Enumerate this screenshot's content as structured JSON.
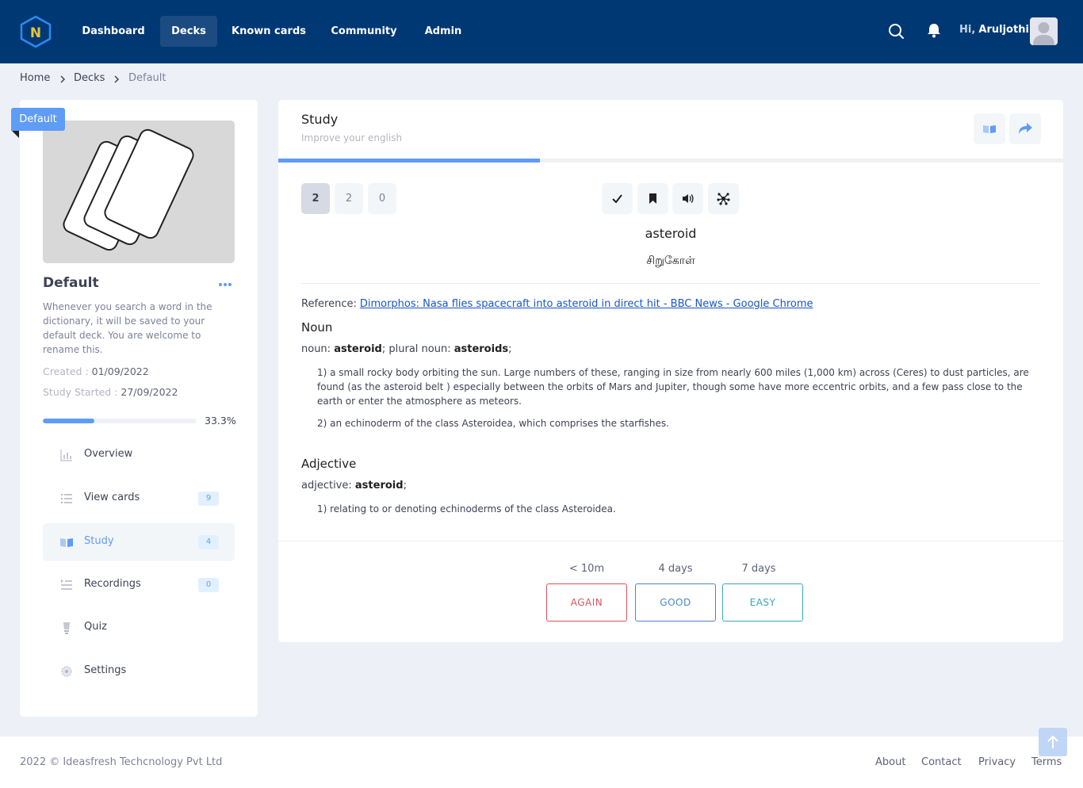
{
  "header": {
    "logo_letter": "N",
    "nav": [
      {
        "label": "Dashboard"
      },
      {
        "label": "Decks"
      },
      {
        "label": "Known cards"
      },
      {
        "label": "Community"
      },
      {
        "label": "Admin"
      }
    ],
    "greeting_prefix": "Hi,",
    "user_name": "Aruljothi"
  },
  "breadcrumb": [
    "Home",
    "Decks",
    "Default"
  ],
  "deck": {
    "ribbon": "Default",
    "title": "Default",
    "description": "Whenever you search a word in the dictionary, it will be saved to your default deck. You are welcome to rename this.",
    "created_label": "Created :",
    "created_value": "01/09/2022",
    "started_label": "Study Started :",
    "started_value": "27/09/2022",
    "progress": 0.333,
    "progress_label": "33.3%"
  },
  "menu": [
    {
      "label": "Overview",
      "icon": "chart-icon"
    },
    {
      "label": "View cards",
      "icon": "list-icon",
      "badge": "9"
    },
    {
      "label": "Study",
      "icon": "book-icon",
      "badge": "4"
    },
    {
      "label": "Recordings",
      "icon": "recordings-icon",
      "badge": "0"
    },
    {
      "label": "Quiz",
      "icon": "bulb-icon"
    },
    {
      "label": "Settings",
      "icon": "gear-icon"
    }
  ],
  "study": {
    "title": "Study",
    "subtitle": "Improve your english",
    "progress": 0.333,
    "counts": [
      "2",
      "2",
      "0"
    ],
    "word": "asteroid",
    "translation": "சிறுகோள்",
    "reference_label": "Reference:",
    "reference_link": "Dimorphos: Nasa flies spacecraft into asteroid in direct hit - BBC News - Google Chrome",
    "noun_head": "Noun",
    "noun_forms_label": "noun:",
    "noun_form": "asteroid",
    "plural_label": "; plural noun:",
    "plural_form": "asteroids",
    "form_end": ";",
    "noun_defs": [
      "1)  a small rocky body orbiting the sun. Large numbers of these, ranging in size from nearly 600 miles (1,000 km) across (Ceres) to dust particles, are found (as the asteroid belt ) especially between the orbits of Mars and Jupiter, though some have more eccentric orbits, and a few pass close to the earth or enter the atmosphere as meteors.",
      "2)  an echinoderm of the class Asteroidea, which comprises the starfishes."
    ],
    "adj_head": "Adjective",
    "adj_forms_label": "adjective:",
    "adj_form": "asteroid",
    "adj_defs": [
      "1)  relating to or denoting echinoderms of the class Asteroidea."
    ],
    "intervals": [
      "< 10m",
      "4 days",
      "7 days"
    ],
    "buttons": [
      "AGAIN",
      "GOOD",
      "EASY"
    ]
  },
  "footer": {
    "copyright": "2022 © Ideasfresh Techcnology Pvt Ltd",
    "links": [
      "About",
      "Contact",
      "Privacy",
      "Terms"
    ]
  }
}
